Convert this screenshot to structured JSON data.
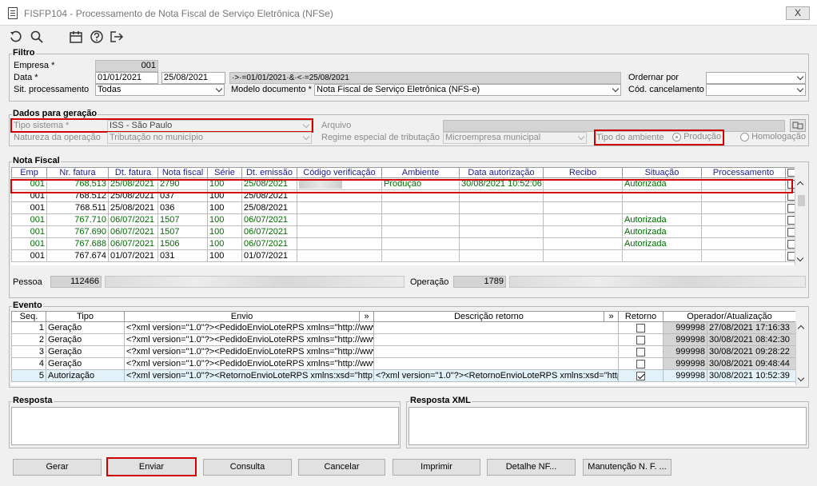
{
  "window": {
    "title": "FISFP104 - Processamento de Nota Fiscal de Serviço Eletrônica (NFSe)",
    "close": "X"
  },
  "toolbar": {
    "icons": [
      "undo-icon",
      "search-icon",
      "calendar-icon",
      "help-icon",
      "exit-icon"
    ]
  },
  "filtro": {
    "title": "Filtro",
    "empresa_label": "Empresa *",
    "empresa_value": "001",
    "data_label": "Data *",
    "data_from": "01/01/2021",
    "data_to": "25/08/2021",
    "data_expr": "·>·=01/01/2021·&·<·=25/08/2021",
    "sit_label": "Sit. processamento",
    "sit_value": "Todas",
    "modelo_label": "Modelo documento *",
    "modelo_value": "Nota Fiscal de Serviço Eletrônica (NFS-e)",
    "ordenar_label": "Ordernar por",
    "ordenar_value": "",
    "cod_label": "Cód. cancelamento",
    "cod_value": ""
  },
  "dados": {
    "title": "Dados para geração",
    "tipo_label": "Tipo sistema *",
    "tipo_value": "ISS - São Paulo",
    "arquivo_label": "Arquivo",
    "natureza_label": "Natureza da operação",
    "natureza_value": "Tributação no município",
    "regime_label": "Regime especial de tributação",
    "regime_value": "Microempresa municipal",
    "ambiente_label": "Tipo do ambiente",
    "producao": "Produção",
    "homologacao": "Homologação"
  },
  "nota": {
    "title": "Nota Fiscal",
    "columns": [
      "Emp",
      "Nr. fatura",
      "Dt. fatura",
      "Nota fiscal",
      "Série",
      "Dt. emissão",
      "Código verificação",
      "Ambiente",
      "Data autorização",
      "Recibo",
      "Situação",
      "Processamento"
    ],
    "rows": [
      {
        "emp": "001",
        "nr": "768.513",
        "dt": "25/08/2021",
        "nf": "2790",
        "serie": "100",
        "emissao": "25/08/2021",
        "ambiente": "Produção",
        "dataaut": "30/08/2021 10:52:06",
        "recibo": "",
        "situacao": "Autorizada"
      },
      {
        "emp": "001",
        "nr": "768.512",
        "dt": "25/08/2021",
        "nf": "037",
        "serie": "100",
        "emissao": "25/08/2021",
        "ambiente": "",
        "dataaut": "",
        "recibo": "",
        "situacao": ""
      },
      {
        "emp": "001",
        "nr": "768.511",
        "dt": "25/08/2021",
        "nf": "036",
        "serie": "100",
        "emissao": "25/08/2021",
        "ambiente": "",
        "dataaut": "",
        "recibo": "",
        "situacao": ""
      },
      {
        "emp": "001",
        "nr": "767.710",
        "dt": "06/07/2021",
        "nf": "1507",
        "serie": "100",
        "emissao": "06/07/2021",
        "ambiente": "",
        "dataaut": "",
        "recibo": "",
        "situacao": "Autorizada"
      },
      {
        "emp": "001",
        "nr": "767.690",
        "dt": "06/07/2021",
        "nf": "1507",
        "serie": "100",
        "emissao": "06/07/2021",
        "ambiente": "",
        "dataaut": "",
        "recibo": "",
        "situacao": "Autorizada"
      },
      {
        "emp": "001",
        "nr": "767.688",
        "dt": "06/07/2021",
        "nf": "1506",
        "serie": "100",
        "emissao": "06/07/2021",
        "ambiente": "",
        "dataaut": "",
        "recibo": "",
        "situacao": "Autorizada"
      },
      {
        "emp": "001",
        "nr": "767.674",
        "dt": "01/07/2021",
        "nf": "031",
        "serie": "100",
        "emissao": "01/07/2021",
        "ambiente": "",
        "dataaut": "",
        "recibo": "",
        "situacao": ""
      }
    ],
    "pessoa_label": "Pessoa",
    "pessoa_value": "112466",
    "operacao_label": "Operação",
    "operacao_value": "1789"
  },
  "evento": {
    "title": "Evento",
    "columns": [
      "Seq.",
      "Tipo",
      "Envio",
      "»",
      "Descrição retorno",
      "»",
      "Retorno",
      "Operador/Atualização"
    ],
    "rows": [
      {
        "seq": "1",
        "tipo": "Geração",
        "envio": "<?xml version=\"1.0\"?><PedidoEnvioLoteRPS xmlns=\"http://www",
        "retorno": "",
        "checked": false,
        "op": "999998",
        "upd": "27/08/2021 17:16:33"
      },
      {
        "seq": "2",
        "tipo": "Geração",
        "envio": "<?xml version=\"1.0\"?><PedidoEnvioLoteRPS xmlns=\"http://www",
        "retorno": "",
        "checked": false,
        "op": "999998",
        "upd": "30/08/2021 08:42:30"
      },
      {
        "seq": "3",
        "tipo": "Geração",
        "envio": "<?xml version=\"1.0\"?><PedidoEnvioLoteRPS xmlns=\"http://www",
        "retorno": "",
        "checked": false,
        "op": "999998",
        "upd": "30/08/2021 09:28:22"
      },
      {
        "seq": "4",
        "tipo": "Geração",
        "envio": "<?xml version=\"1.0\"?><PedidoEnvioLoteRPS xmlns=\"http://www",
        "retorno": "",
        "checked": false,
        "op": "999998",
        "upd": "30/08/2021 09:48:44"
      },
      {
        "seq": "5",
        "tipo": "Autorização",
        "envio": "<?xml version=\"1.0\"?><RetornoEnvioLoteRPS xmlns:xsd=\"http://v",
        "retorno": "<?xml version=\"1.0\"?><RetornoEnvioLoteRPS xmlns:xsd=\"http:/",
        "checked": true,
        "op": "999998",
        "upd": "30/08/2021 10:52:39"
      }
    ]
  },
  "resposta": {
    "title": "Resposta",
    "xml_title": "Resposta XML"
  },
  "buttons": {
    "gerar": "Gerar",
    "enviar": "Enviar",
    "consulta": "Consulta",
    "cancelar": "Cancelar",
    "imprimir": "Imprimir",
    "detalhe": "Detalhe NF...",
    "manutencao": "Manutenção N. F. ..."
  }
}
